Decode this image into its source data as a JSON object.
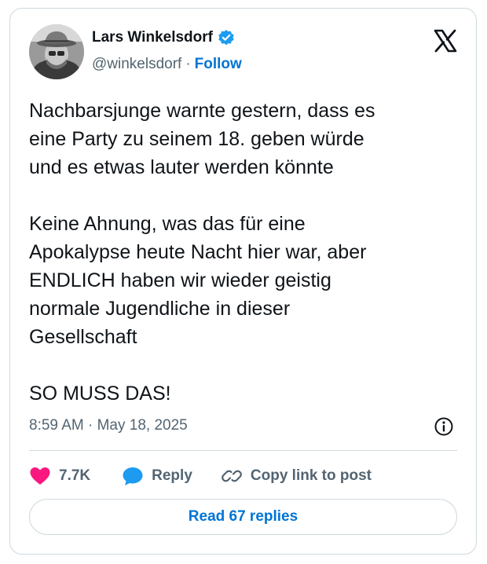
{
  "author": {
    "name": "Lars Winkelsdorf",
    "handle": "@winkelsdorf",
    "separator": "·",
    "follow_label": "Follow",
    "verified_icon": "verified-badge-icon",
    "avatar_icon": "profile-photo"
  },
  "brand": {
    "logo_icon": "x-logo-icon"
  },
  "tweet": {
    "text": "Nachbarsjunge warnte gestern, dass es\neine Party zu seinem 18. geben würde\nund es etwas lauter werden könnte\n\nKeine Ahnung, was das für eine\nApokalypse heute Nacht hier war, aber\nENDLICH haben wir wieder geistig\nnormale Jugendliche in dieser\nGesellschaft\n\nSO MUSS DAS!",
    "timestamp": "8:59 AM · May 18, 2025",
    "info_icon": "info-icon"
  },
  "actions": {
    "likes": "7.7K",
    "like_icon": "heart-icon",
    "reply_label": "Reply",
    "reply_icon": "speech-bubble-icon",
    "copy_label": "Copy link to post",
    "copy_icon": "link-icon"
  },
  "replies": {
    "label": "Read 67 replies"
  },
  "colors": {
    "accent_blue": "#0074d4",
    "heart_pink": "#f91880",
    "reply_blue": "#1d9bf0",
    "text_primary": "#0f1419",
    "text_secondary": "#536471",
    "border": "#cfd9de"
  }
}
